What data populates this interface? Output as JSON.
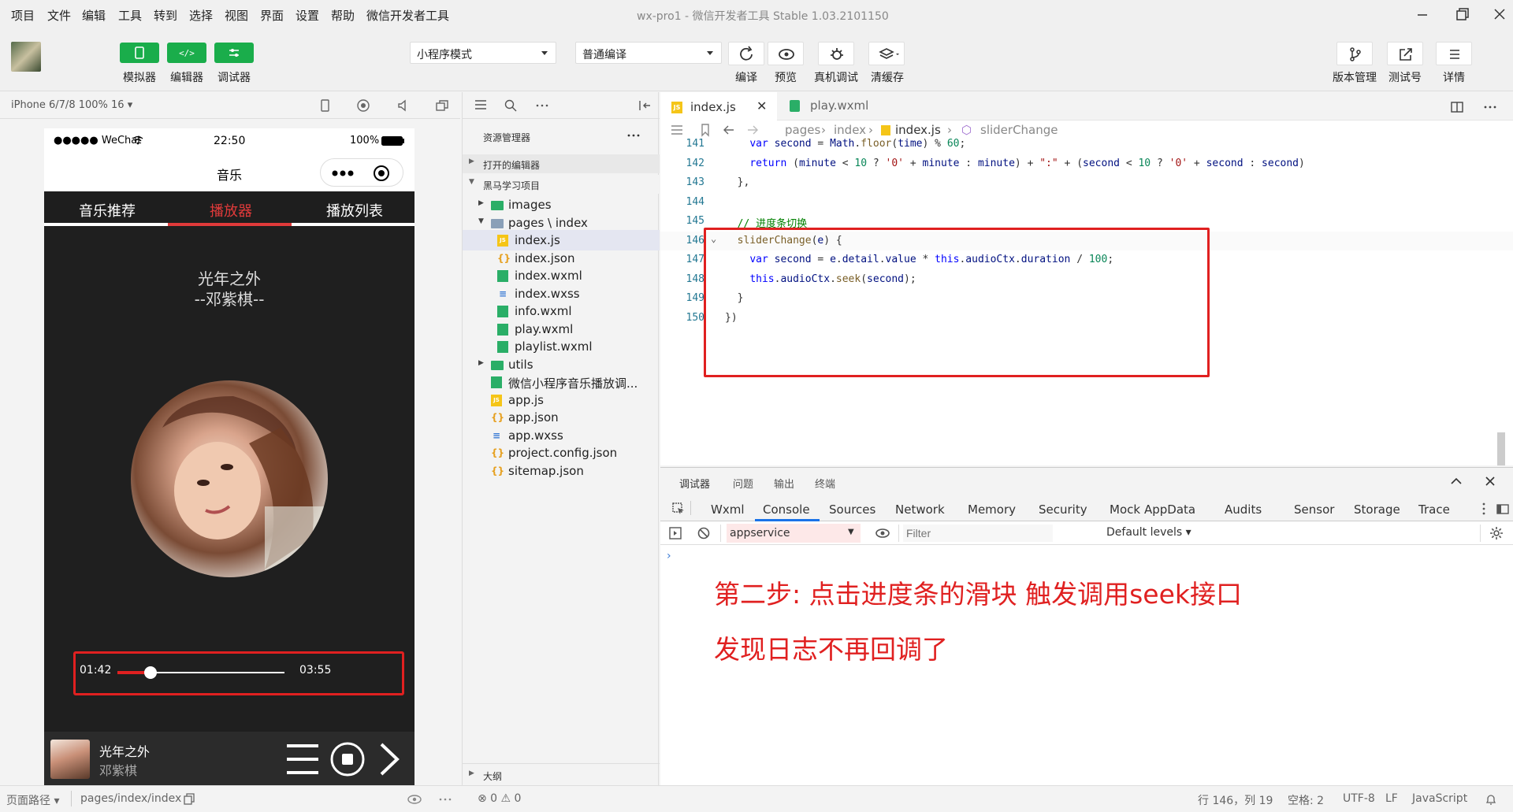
{
  "menu": [
    "项目",
    "文件",
    "编辑",
    "工具",
    "转到",
    "选择",
    "视图",
    "界面",
    "设置",
    "帮助",
    "微信开发者工具"
  ],
  "window_title": "wx-pro1 - 微信开发者工具 Stable 1.03.2101150",
  "toolbar": {
    "simulator": "模拟器",
    "editor": "编辑器",
    "debugger": "调试器",
    "mode_select": "小程序模式",
    "compile_select": "普通编译",
    "compile": "编译",
    "preview": "预览",
    "remote_debug": "真机调试",
    "clear_cache": "清缓存",
    "version": "版本管理",
    "test": "测试号",
    "details": "详情"
  },
  "simulator": {
    "device": "iPhone 6/7/8 100% 16 ▾",
    "status": {
      "carrier": "●●●●● WeChat",
      "time": "22:50",
      "battery": "100%"
    },
    "nav_title": "音乐",
    "tabs": [
      "音乐推荐",
      "播放器",
      "播放列表"
    ],
    "song": "光年之外",
    "artist_line": "--邓紫棋--",
    "current_time": "01:42",
    "total_time": "03:55",
    "progress_fraction": 0.2,
    "bottom_song": "光年之外",
    "bottom_artist": "邓紫棋"
  },
  "explorer": {
    "title": "资源管理器",
    "open_editors": "打开的编辑器",
    "project": "黑马学习项目",
    "items": [
      {
        "name": "images",
        "type": "folder",
        "indent": 1
      },
      {
        "name": "pages \\ index",
        "type": "folder-open",
        "indent": 1
      },
      {
        "name": "index.js",
        "type": "js",
        "indent": 2
      },
      {
        "name": "index.json",
        "type": "json",
        "indent": 2
      },
      {
        "name": "index.wxml",
        "type": "wxml",
        "indent": 2
      },
      {
        "name": "index.wxss",
        "type": "wxss",
        "indent": 2
      },
      {
        "name": "info.wxml",
        "type": "wxml",
        "indent": 2
      },
      {
        "name": "play.wxml",
        "type": "wxml",
        "indent": 2
      },
      {
        "name": "playlist.wxml",
        "type": "wxml",
        "indent": 2
      },
      {
        "name": "utils",
        "type": "folder",
        "indent": 1
      },
      {
        "name": "微信小程序音乐播放调...",
        "type": "misc",
        "indent": 1
      },
      {
        "name": "app.js",
        "type": "js",
        "indent": 1
      },
      {
        "name": "app.json",
        "type": "json",
        "indent": 1
      },
      {
        "name": "app.wxss",
        "type": "wxss",
        "indent": 1
      },
      {
        "name": "project.config.json",
        "type": "json",
        "indent": 1
      },
      {
        "name": "sitemap.json",
        "type": "json",
        "indent": 1
      }
    ],
    "outline": "大纲"
  },
  "editor": {
    "tabs": [
      "index.js",
      "play.wxml"
    ],
    "breadcrumb": [
      "pages",
      "index",
      "index.js",
      "sliderChange"
    ],
    "lines": [
      {
        "n": "141",
        "html": "    <span class='kw'>var</span> <span class='var'>second</span> = <span class='var'>Math</span>.<span class='fn'>floor</span>(<span class='var'>time</span>) % <span class='num'>60</span>;"
      },
      {
        "n": "142",
        "html": "    <span class='kw'>return</span> (<span class='var'>minute</span> &lt; <span class='num'>10</span> ? <span class='str'>'0'</span> + <span class='var'>minute</span> : <span class='var'>minute</span>) + <span class='str'>\":\"</span> + (<span class='var'>second</span> &lt; <span class='num'>10</span> ? <span class='str'>'0'</span> + <span class='var'>second</span> : <span class='var'>second</span>)"
      },
      {
        "n": "143",
        "html": "  },"
      },
      {
        "n": "144",
        "html": ""
      },
      {
        "n": "145",
        "html": "  <span class='cm'>// 进度条切换</span>"
      },
      {
        "n": "146",
        "html": "  <span class='fn'>sliderChange</span>(<span class='var'>e</span>) {"
      },
      {
        "n": "147",
        "html": "    <span class='kw'>var</span> <span class='var'>second</span> = <span class='var'>e</span>.<span class='var'>detail</span>.<span class='var'>value</span> * <span class='kw'>this</span>.<span class='var'>audioCtx</span>.<span class='var'>duration</span> / <span class='num'>100</span>;"
      },
      {
        "n": "148",
        "html": "    <span class='kw'>this</span>.<span class='var'>audioCtx</span>.<span class='fn'>seek</span>(<span class='var'>second</span>);"
      },
      {
        "n": "149",
        "html": "  }"
      },
      {
        "n": "150",
        "html": "})"
      }
    ]
  },
  "devtools": {
    "top_tabs": [
      "调试器",
      "问题",
      "输出",
      "终端"
    ],
    "tabs": [
      "Wxml",
      "Console",
      "Sources",
      "Network",
      "Memory",
      "Security",
      "Mock",
      "AppData",
      "Audits",
      "Sensor",
      "Storage",
      "Trace"
    ],
    "context": "appservice",
    "filter_placeholder": "Filter",
    "levels": "Default levels ▾",
    "note1": "第二步: 点击进度条的滑块 触发调用seek接口",
    "note2": "发现日志不再回调了"
  },
  "statusbar": {
    "page_path": "页面路径 ▾",
    "path": "pages/index/index",
    "errors": "⊗ 0 ⚠ 0",
    "position": "行 146，列 19",
    "spaces": "空格: 2",
    "encoding": "UTF-8",
    "eol": "LF",
    "language": "JavaScript"
  },
  "colors": {
    "accent_green": "#1aad4b",
    "annotation_red": "#e02020",
    "phone_bg": "#1f1f1f",
    "active_tab_red": "#e03a3a"
  }
}
